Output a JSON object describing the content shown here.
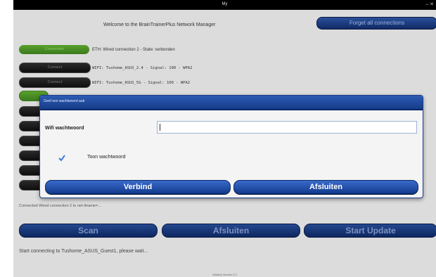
{
  "window": {
    "title": "My"
  },
  "header": {
    "welcome": "Welcome to the BrainTrainerPlus Network Manager",
    "forget_label": "Forget all connections"
  },
  "connections": [
    {
      "button": "Connected",
      "text": "ETH: Wired connection 2 - State: verbonden",
      "state": "connected"
    },
    {
      "button": "Connect",
      "text": "WIFI: Tushome_ASUS_2.4     - Signal:  100  - WPA2",
      "state": "idle"
    },
    {
      "button": "Connect",
      "text": "WIFI: Tushome_ASUS_5G      - Signal:  100  - WPA2",
      "state": "idle"
    }
  ],
  "status_line": "Connected Wired connection 2 to net-ifname=...",
  "buttons": {
    "scan": "Scan",
    "close": "Afsluiten",
    "update": "Start Update"
  },
  "connecting_text": "Start connecting to Tushome_ASUS_Guest1, please wait...",
  "version": "Widdey Version 2.0",
  "dialog": {
    "title": "Geef een wachtwoord aub",
    "password_label": "Wifi wachtwoord",
    "password_value": "",
    "show_password_label": "Toon wachtwoord",
    "show_password_checked": true,
    "connect_label": "Verbind",
    "close_label": "Afsluiten"
  }
}
